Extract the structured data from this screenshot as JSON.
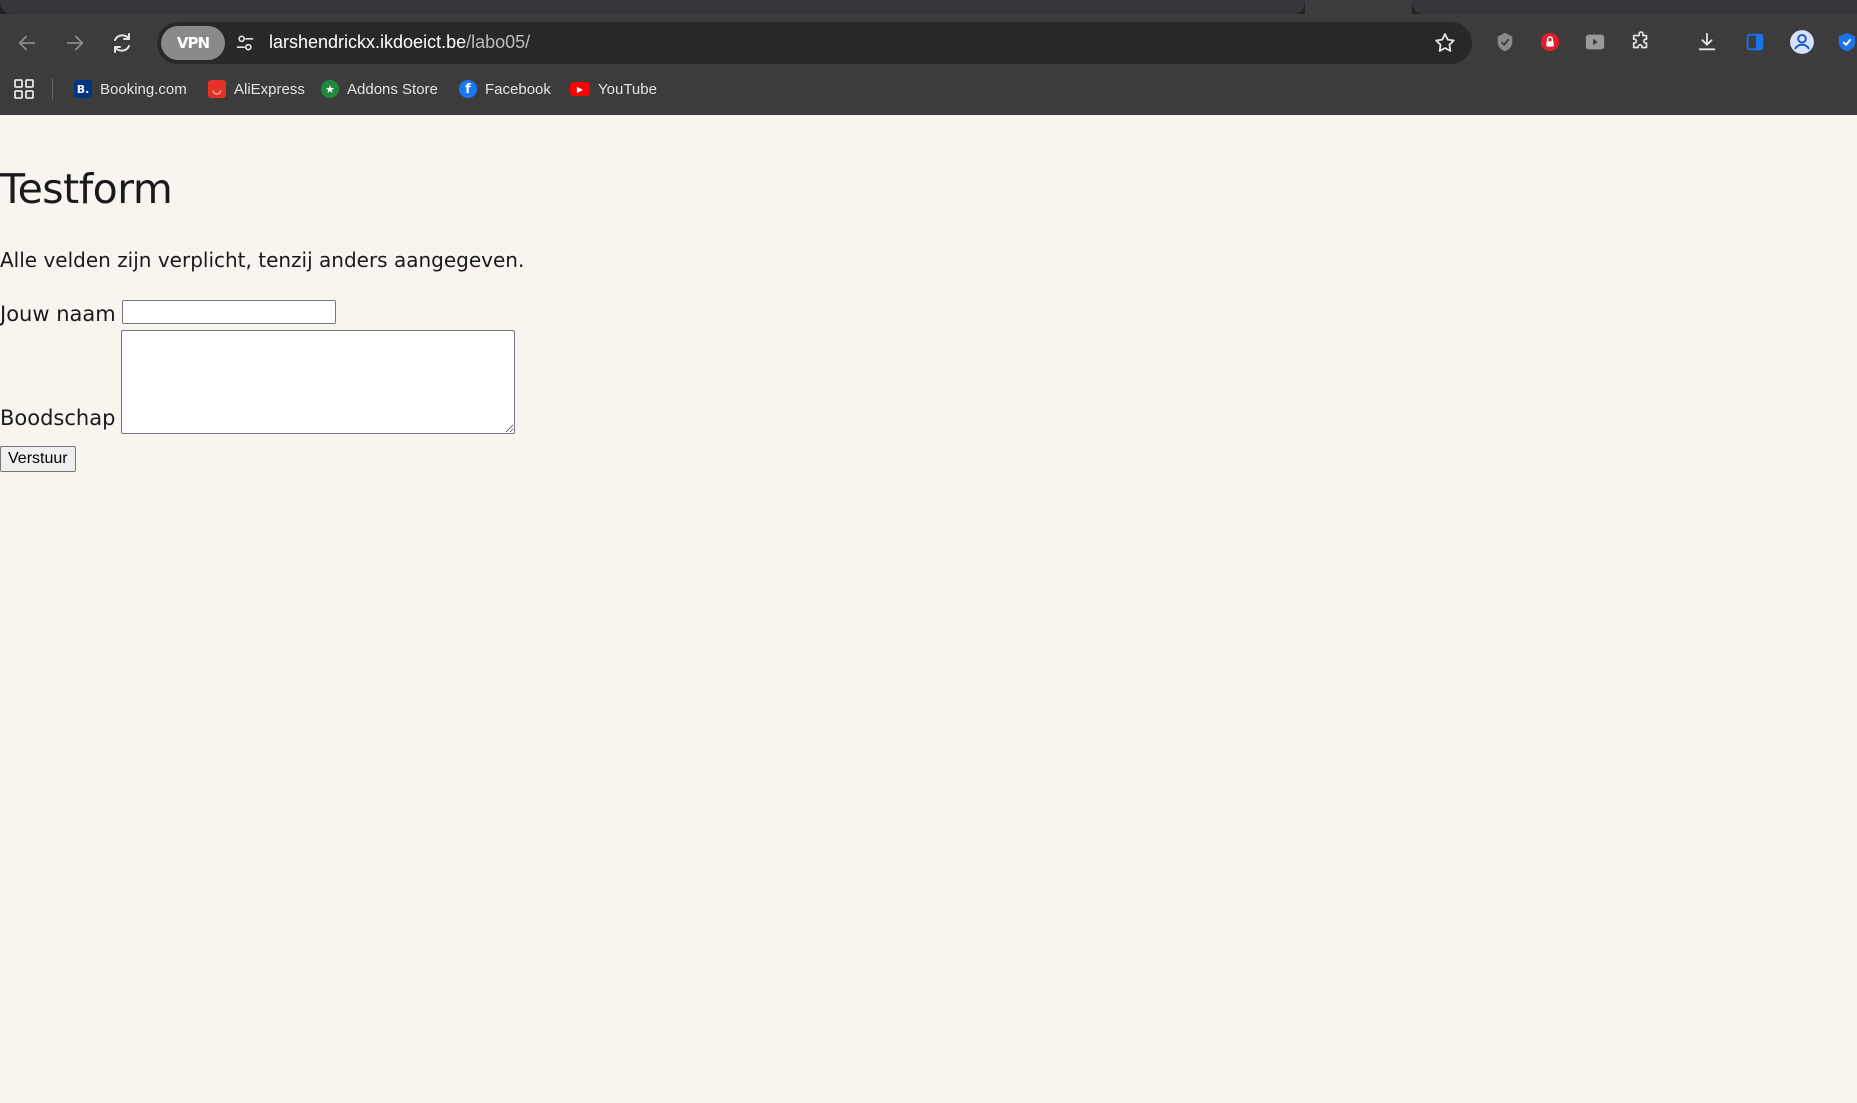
{
  "browser": {
    "vpn_badge": "VPN",
    "url_host": "larshendrickx.ikdoeict.be",
    "url_path": "/labo05/",
    "bookmarks": [
      {
        "label": "Booking.com",
        "icon": "booking-icon",
        "color": "#003580",
        "glyph": "B."
      },
      {
        "label": "AliExpress",
        "icon": "aliexpress-icon",
        "color": "#e43225",
        "glyph": "◡"
      },
      {
        "label": "Addons Store",
        "icon": "addons-store-icon",
        "color": "#1f8a3c",
        "glyph": "★"
      },
      {
        "label": "Facebook",
        "icon": "facebook-icon",
        "color": "#1877f2",
        "glyph": "f"
      },
      {
        "label": "YouTube",
        "icon": "youtube-icon",
        "color": "#ff0000",
        "glyph": "▶"
      }
    ]
  },
  "page": {
    "title": "Testform",
    "intro": "Alle velden zijn verplicht, tenzij anders aangegeven.",
    "name_label": "Jouw naam",
    "name_value": "",
    "message_label": "Boodschap",
    "message_value": "",
    "submit_label": "Verstuur"
  },
  "colors": {
    "page_background": "#f8f5ef",
    "chrome_background": "#3c3c3c",
    "omnibox_background": "#282828"
  }
}
